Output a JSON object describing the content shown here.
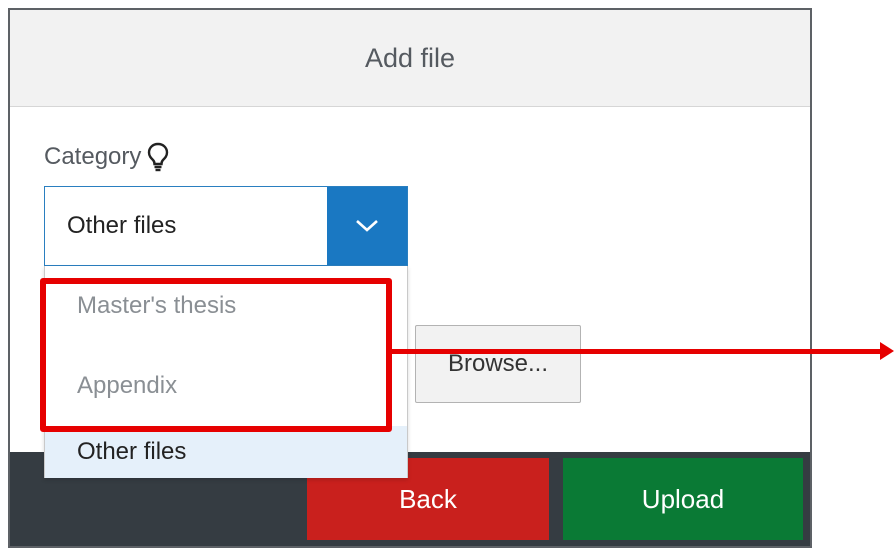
{
  "dialog": {
    "title": "Add file"
  },
  "category": {
    "label": "Category",
    "hint_icon": "lightbulb-icon",
    "selected_value": "Other files",
    "options": [
      {
        "label": "Master's thesis",
        "state": "disabled"
      },
      {
        "label": "Appendix",
        "state": "disabled"
      },
      {
        "label": "Other files",
        "state": "selected"
      }
    ]
  },
  "file": {
    "browse_label": "Browse..."
  },
  "footer": {
    "back_label": "Back",
    "upload_label": "Upload"
  },
  "colors": {
    "accent": "#1a78c2",
    "back": "#c9201d",
    "upload": "#0a7a35",
    "footer_bg": "#353c42",
    "annotation": "#e60000",
    "selected_option_bg": "#e5f0fa"
  }
}
